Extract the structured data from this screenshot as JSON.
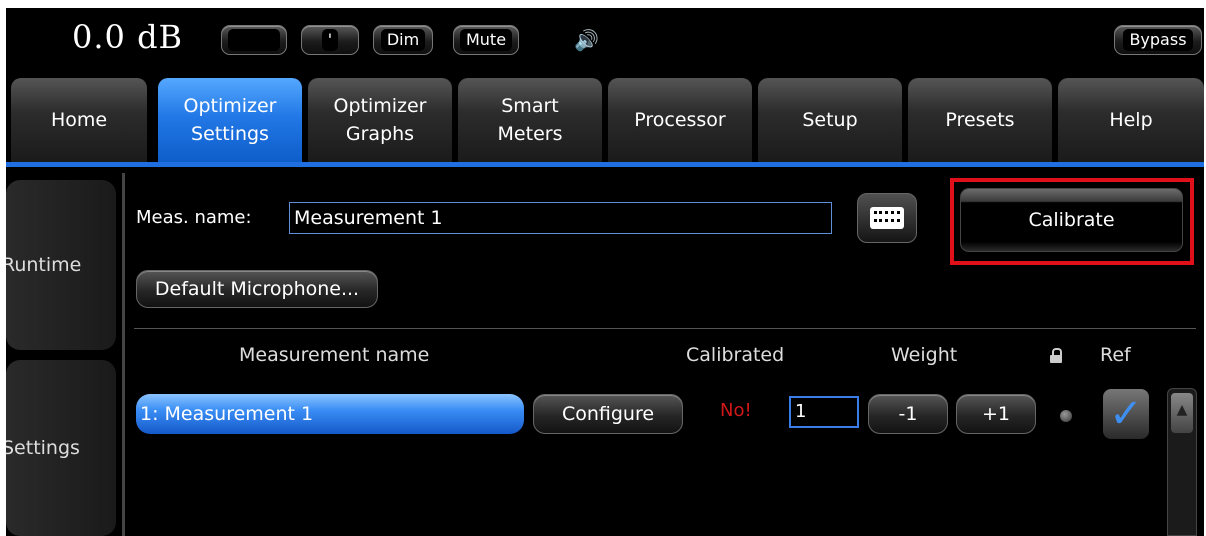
{
  "topbar": {
    "level": "0.0 dB",
    "btn_blank": "",
    "btn_tick": "'",
    "dim": "Dim",
    "mute": "Mute",
    "bypass": "Bypass"
  },
  "tabs": [
    {
      "label": "Home"
    },
    {
      "label": "Optimizer\nSettings",
      "active": true
    },
    {
      "label": "Optimizer\nGraphs"
    },
    {
      "label": "Smart\nMeters"
    },
    {
      "label": "Processor"
    },
    {
      "label": "Setup"
    },
    {
      "label": "Presets"
    },
    {
      "label": "Help"
    }
  ],
  "side": {
    "runtime": "Runtime",
    "settings": "Settings"
  },
  "measurement": {
    "name_label": "Meas. name:",
    "name_value": "Measurement 1",
    "calibrate": "Calibrate",
    "microphone": "Default Microphone..."
  },
  "table": {
    "headers": {
      "name": "Measurement name",
      "calibrated": "Calibrated",
      "weight": "Weight",
      "ref": "Ref"
    },
    "rows": [
      {
        "name": "1: Measurement 1",
        "configure": "Configure",
        "calibrated": "No!",
        "weight": "1",
        "minus": "-1",
        "plus": "+1",
        "ref_checked": true
      }
    ]
  },
  "colors": {
    "accent": "#1f6fe0",
    "highlight_outline": "#e0101b",
    "not_calibrated": "#d11818"
  }
}
